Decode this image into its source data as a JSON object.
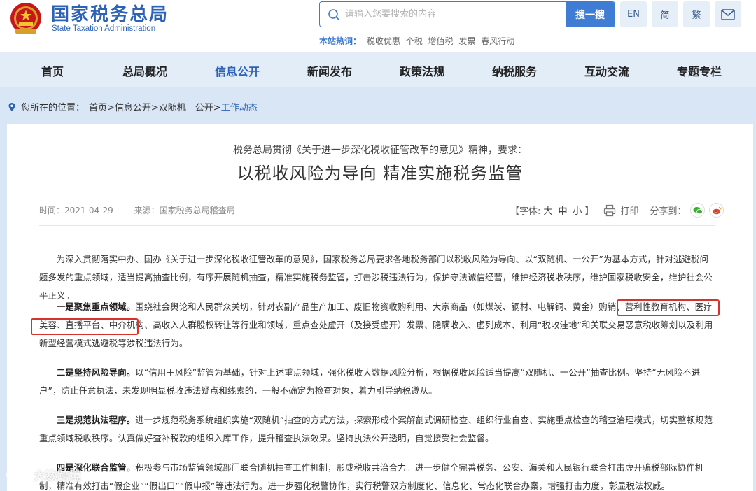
{
  "header": {
    "site_name_cn": "国家税务总局",
    "site_name_en": "State Taxation Administration",
    "search": {
      "placeholder": "请输入您要搜索的内容",
      "button_label": "搜一搜"
    },
    "languages": [
      "EN",
      "简",
      "繁"
    ],
    "hot_label": "本站热词：",
    "hot_words": [
      "税收优惠",
      "个税",
      "增值税",
      "发票",
      "春风行动"
    ]
  },
  "nav": {
    "items": [
      "首页",
      "总局概况",
      "信息公开",
      "新闻发布",
      "政策法规",
      "纳税服务",
      "互动交流",
      "专题专栏"
    ],
    "active": "信息公开"
  },
  "breadcrumb": {
    "label": "您所在的位置：",
    "path": "首页>信息公开>双随机—公开>",
    "current": "工作动态"
  },
  "article": {
    "pre_title": "税务总局贯彻《关于进一步深化税收征管改革的意见》精神，要求：",
    "title": "以税收风险为导向 精准实施税务监管",
    "time": "时间：2021-04-29",
    "source": "来源：国家税务总局稽查局",
    "font_label": "【字体:",
    "font_sizes": [
      "大",
      "中",
      "小"
    ],
    "font_close": "】",
    "print_label": "打印",
    "share_label": "分享到：",
    "paragraphs": [
      {
        "lead": "",
        "text": "为深入贯彻落实中办、国办《关于进一步深化税收征管改革的意见》，国家税务总局要求各地税务部门以税收风险为导向、以“双随机、一公开”为基本方式，针对逃避税问题多发的重点领域，适当提高抽查比例，有序开展随机抽查，精准实施税务监管，打击涉税违法行为，保护守法诚信经营，维护经济税收秩序，维护国家税收安全，维护社会公平正义。"
      },
      {
        "lead": "一是聚焦重点领域。",
        "text": "围绕社会舆论和人民群众关切，针对农副产品生产加工、废旧物资收购利用、大宗商品（如煤炭、钢材、电解铜、黄金）购销、营利性教育机构、医疗美容、直播平台、中介机构、高收入人群股权转让等行业和领域，重点查处虚开（及接受虚开）发票、隐瞒收入、虚列成本、利用“税收洼地”和关联交易恶意税收筹划以及利用新型经营模式逃避税等涉税违法行为。"
      },
      {
        "lead": "二是坚持风险导向。",
        "text": "以“信用＋风险”监管为基础，针对上述重点领域，强化税收大数据风险分析，根据税收风险适当提高“双随机、一公开”抽查比例。坚持“无风险不进户”，防止任意执法，未发现明显税收违法疑点和线索的，一般不确定为检查对象，着力引导纳税遵从。"
      },
      {
        "lead": "三是规范执法程序。",
        "text": "进一步规范税务系统组织实施“双随机”抽查的方式方法，探索形成个案解剖式调研检查、组织行业自查、实施重点检查的稽查治理模式，切实整顿规范重点领域税收秩序。认真做好查补税款的组织入库工作，提升稽查执法效果。坚持执法公开透明，自觉接受社会监督。"
      },
      {
        "lead": "四是深化联合监管。",
        "text": "积极参与市场监管领域部门联合随机抽查工作机制，形成税收共治合力。进一步健全完善税务、公安、海关和人民银行联合打击虚开骗税部际协作机制，精准有效打击“假企业”“假出口”“假申报”等违法行为。进一步强化税警协作，实行税警双方制度化、信息化、常态化联合办案，增强打击力度，彰显税法权威。"
      }
    ]
  },
  "watermark": "大数跨境",
  "colors": {
    "brand": "#2d63b6",
    "nav_bg": "#e3edf8",
    "band_bg": "#d9e6f5",
    "highlight": "#d9312b",
    "wechat": "#3cb034",
    "weibo": "#e0452c"
  }
}
